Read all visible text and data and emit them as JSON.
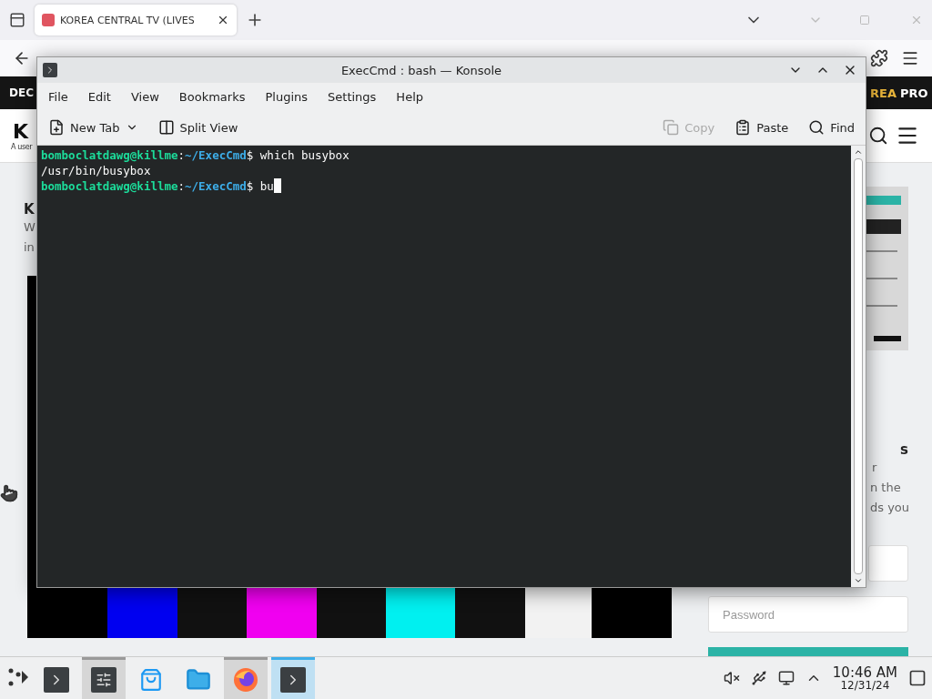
{
  "browser": {
    "tab": {
      "title": "KOREA CENTRAL TV (LIVES",
      "selected": true
    },
    "banner": {
      "left": "DEC",
      "brand_a": "REA",
      "brand_b": "PRO"
    },
    "site": {
      "logo": "K",
      "tagline": "A user"
    },
    "article": {
      "heading": "K",
      "lines": [
        "W",
        "in"
      ],
      "video": {
        "kind": "picture"
      }
    },
    "aside": {
      "ad": {
        "kind": "picture"
      },
      "heading": "s",
      "lines": [
        "r",
        "n the",
        "ds you"
      ],
      "password_placeholder": "Password"
    }
  },
  "konsole": {
    "title": "ExecCmd : bash — Konsole",
    "menu": [
      "File",
      "Edit",
      "View",
      "Bookmarks",
      "Plugins",
      "Settings",
      "Help"
    ],
    "toolbar": [
      {
        "label": "New Tab",
        "kind": "newtab",
        "disabled": false
      },
      {
        "label": "Split View",
        "kind": "split",
        "disabled": false
      },
      {
        "label": "Copy",
        "kind": "copy",
        "disabled": true
      },
      {
        "label": "Paste",
        "kind": "paste",
        "disabled": false
      },
      {
        "label": "Find",
        "kind": "find",
        "disabled": false
      }
    ],
    "lines": [
      {
        "cursor": false,
        "segments": [
          {
            "kind": "user",
            "text": "bomboclatdawg@killme"
          },
          {
            "kind": "plain",
            "text": ":"
          },
          {
            "kind": "path",
            "text": "~/ExecCmd"
          },
          {
            "kind": "plain",
            "text": "$ which busybox"
          }
        ]
      },
      {
        "cursor": false,
        "segments": [
          {
            "kind": "plain",
            "text": "/usr/bin/busybox"
          }
        ]
      },
      {
        "cursor": true,
        "segments": [
          {
            "kind": "user",
            "text": "bomboclatdawg@killme"
          },
          {
            "kind": "plain",
            "text": ":"
          },
          {
            "kind": "path",
            "text": "~/ExecCmd"
          },
          {
            "kind": "plain",
            "text": "$ bu"
          }
        ]
      }
    ]
  },
  "taskbar": {
    "items": [
      {
        "kind": "terminal",
        "open": false,
        "selected": false
      },
      {
        "kind": "settings",
        "open": true,
        "selected": false
      },
      {
        "kind": "store",
        "open": false,
        "selected": false
      },
      {
        "kind": "folder",
        "open": false,
        "selected": false
      },
      {
        "kind": "firefox",
        "open": true,
        "selected": false
      },
      {
        "kind": "terminal",
        "open": true,
        "selected": true
      }
    ],
    "time": "10:46 AM",
    "date": "12/31/24"
  }
}
